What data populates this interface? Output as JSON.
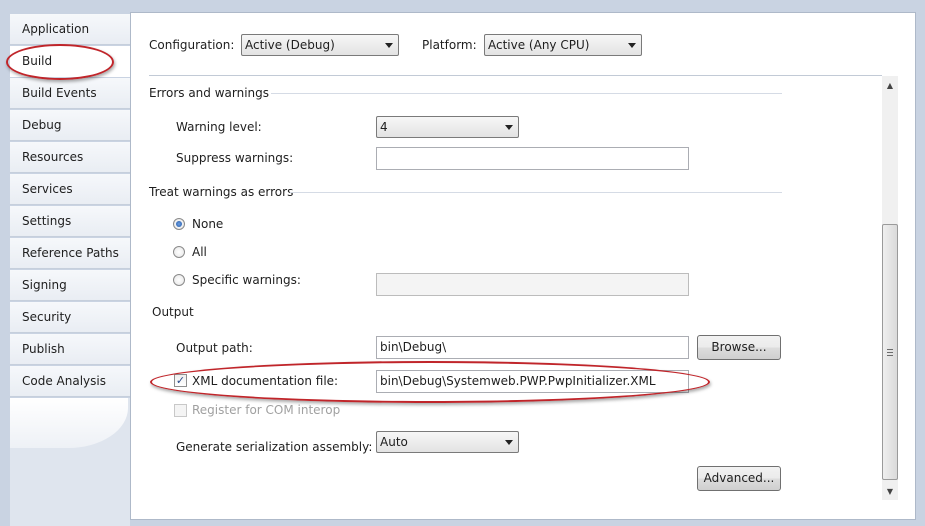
{
  "sidebar": {
    "items": [
      {
        "label": "Application"
      },
      {
        "label": "Build",
        "selected": true
      },
      {
        "label": "Build Events"
      },
      {
        "label": "Debug"
      },
      {
        "label": "Resources"
      },
      {
        "label": "Services"
      },
      {
        "label": "Settings"
      },
      {
        "label": "Reference Paths"
      },
      {
        "label": "Signing"
      },
      {
        "label": "Security"
      },
      {
        "label": "Publish"
      },
      {
        "label": "Code Analysis"
      }
    ]
  },
  "header": {
    "configuration_label": "Configuration:",
    "configuration_value": "Active (Debug)",
    "platform_label": "Platform:",
    "platform_value": "Active (Any CPU)"
  },
  "errors_warnings": {
    "title": "Errors and warnings",
    "warning_level_label": "Warning level:",
    "warning_level_value": "4",
    "suppress_label": "Suppress warnings:",
    "suppress_value": ""
  },
  "treat_warnings": {
    "title": "Treat warnings as errors",
    "options": [
      {
        "label": "None",
        "selected": true
      },
      {
        "label": "All",
        "selected": false
      },
      {
        "label": "Specific warnings:",
        "selected": false
      }
    ],
    "specific_value": ""
  },
  "output": {
    "title": "Output",
    "output_path_label": "Output path:",
    "output_path_value": "bin\\Debug\\",
    "browse_label": "Browse...",
    "xml_doc_label": "XML documentation file:",
    "xml_doc_checked": true,
    "xml_doc_value": "bin\\Debug\\Systemweb.PWP.PwpInitializer.XML",
    "com_interop_label": "Register for COM interop",
    "com_interop_enabled": false,
    "serialization_label": "Generate serialization assembly:",
    "serialization_value": "Auto",
    "advanced_label": "Advanced..."
  },
  "colors": {
    "highlight": "#c0252a",
    "radio_selected": "#1f56a8",
    "window_background": "#c9d3e2"
  },
  "icons": [
    "chevron-down-icon",
    "scroll-up-icon",
    "scroll-down-icon",
    "checkmark-icon"
  ]
}
